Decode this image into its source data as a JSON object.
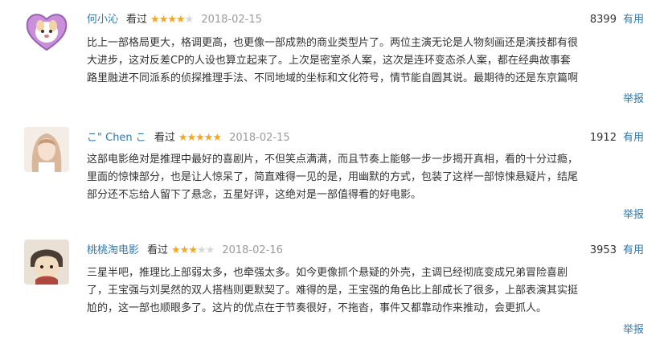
{
  "reviews": [
    {
      "user": "何小沁",
      "watched": "看过",
      "rating": 4,
      "date": "2018-02-15",
      "votes": "8399",
      "useful_label": "有用",
      "lines": [
        "比上一部格局更大，格调更高，也更像一部成熟的商业类型片了。两位主演无论是人物刻画还是演技都有很",
        "大进步，这对反差CP的人设也算立起来了。上次是密室杀人案，这次是连环变态杀人案，都在经典故事套",
        "路里融进不同派系的侦探推理手法、不同地域的坐标和文化符号，情节能自圆其说。最期待的还是东京篇啊"
      ],
      "report_label": "举报"
    },
    {
      "user": "こ\" Chen こ",
      "watched": "看过",
      "rating": 5,
      "date": "2018-02-15",
      "votes": "1912",
      "useful_label": "有用",
      "lines": [
        "这部电影绝对是推理中最好的喜剧片，不但笑点满满，而且节奏上能够一步一步揭开真相，看的十分过瘾，",
        "里面的惊悚部分，也是让人惊呆了，简直难得一见的是，用幽默的方式，包装了这样一部惊悚悬疑片，结尾",
        "部分还不忘给人留下了悬念，五星好评，这绝对是一部值得看的好电影。"
      ],
      "report_label": "举报"
    },
    {
      "user": "桃桃淘电影",
      "watched": "看过",
      "rating": 3,
      "date": "2018-02-16",
      "votes": "3953",
      "useful_label": "有用",
      "lines": [
        "三星半吧，推理比上部弱太多，也牵强太多。如今更像抓个悬疑的外壳，主调已经彻底变成兄弟冒险喜剧",
        "了，王宝强与刘昊然的双人搭档则更默契了。难得的是，王宝强的角色比上部成长了很多，上部表演其实挺",
        "尬的，这一部也顺眼多了。这片的优点在于节奏很好，不拖沓，事件又都靠动作来推动，会更抓人。"
      ],
      "report_label": "举报"
    }
  ],
  "colors": {
    "link": "#3377aa",
    "star_on": "#f5a623",
    "star_off": "#d6d6d6",
    "date": "#9a9a9a"
  },
  "icons": {
    "star_filled": "★",
    "star_empty": "★"
  }
}
